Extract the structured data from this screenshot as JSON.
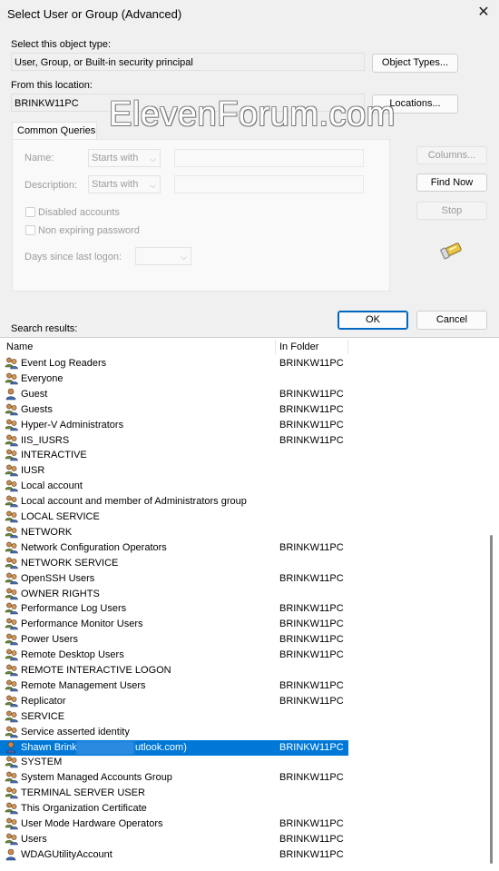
{
  "window": {
    "title": "Select User or Group (Advanced)"
  },
  "object_type": {
    "label": "Select this object type:",
    "value": "User, Group, or Built-in security principal",
    "button": "Object Types..."
  },
  "location": {
    "label": "From this location:",
    "value": "BRINKW11PC",
    "button": "Locations..."
  },
  "watermark": "ElevenForum.com",
  "common_queries": {
    "tab": "Common Queries",
    "name_label": "Name:",
    "name_match": "Starts with",
    "description_label": "Description:",
    "description_match": "Starts with",
    "disabled_accounts": "Disabled accounts",
    "non_expiring_password": "Non expiring password",
    "days_label": "Days since last logon:"
  },
  "buttons": {
    "columns": "Columns...",
    "find_now": "Find Now",
    "stop": "Stop",
    "ok": "OK",
    "cancel": "Cancel"
  },
  "search_results": {
    "label": "Search results:",
    "headers": {
      "name": "Name",
      "folder": "In Folder"
    },
    "rows": [
      {
        "name": "Event Log Readers",
        "folder": "BRINKW11PC",
        "icon": "group-icon"
      },
      {
        "name": "Everyone",
        "folder": "",
        "icon": "group-icon"
      },
      {
        "name": "Guest",
        "folder": "BRINKW11PC",
        "icon": "user-icon"
      },
      {
        "name": "Guests",
        "folder": "BRINKW11PC",
        "icon": "group-icon"
      },
      {
        "name": "Hyper-V Administrators",
        "folder": "BRINKW11PC",
        "icon": "group-icon"
      },
      {
        "name": "IIS_IUSRS",
        "folder": "BRINKW11PC",
        "icon": "group-icon"
      },
      {
        "name": "INTERACTIVE",
        "folder": "",
        "icon": "group-icon"
      },
      {
        "name": "IUSR",
        "folder": "",
        "icon": "group-icon"
      },
      {
        "name": "Local account",
        "folder": "",
        "icon": "group-icon"
      },
      {
        "name": "Local account and member of Administrators group",
        "folder": "",
        "icon": "group-icon"
      },
      {
        "name": "LOCAL SERVICE",
        "folder": "",
        "icon": "group-icon"
      },
      {
        "name": "NETWORK",
        "folder": "",
        "icon": "group-icon"
      },
      {
        "name": "Network Configuration Operators",
        "folder": "BRINKW11PC",
        "icon": "group-icon"
      },
      {
        "name": "NETWORK SERVICE",
        "folder": "",
        "icon": "group-icon"
      },
      {
        "name": "OpenSSH Users",
        "folder": "BRINKW11PC",
        "icon": "group-icon"
      },
      {
        "name": "OWNER RIGHTS",
        "folder": "",
        "icon": "group-icon"
      },
      {
        "name": "Performance Log Users",
        "folder": "BRINKW11PC",
        "icon": "group-icon"
      },
      {
        "name": "Performance Monitor Users",
        "folder": "BRINKW11PC",
        "icon": "group-icon"
      },
      {
        "name": "Power Users",
        "folder": "BRINKW11PC",
        "icon": "group-icon"
      },
      {
        "name": "Remote Desktop Users",
        "folder": "BRINKW11PC",
        "icon": "group-icon"
      },
      {
        "name": "REMOTE INTERACTIVE LOGON",
        "folder": "",
        "icon": "group-icon"
      },
      {
        "name": "Remote Management Users",
        "folder": "BRINKW11PC",
        "icon": "group-icon"
      },
      {
        "name": "Replicator",
        "folder": "BRINKW11PC",
        "icon": "group-icon"
      },
      {
        "name": "SERVICE",
        "folder": "",
        "icon": "group-icon"
      },
      {
        "name": "Service asserted identity",
        "folder": "",
        "icon": "group-icon"
      },
      {
        "name": "Shawn Brink utlook.com)",
        "folder": "BRINKW11PC",
        "icon": "user-icon",
        "selected": true
      },
      {
        "name": "SYSTEM",
        "folder": "",
        "icon": "group-icon"
      },
      {
        "name": "System Managed Accounts Group",
        "folder": "BRINKW11PC",
        "icon": "group-icon"
      },
      {
        "name": "TERMINAL SERVER USER",
        "folder": "",
        "icon": "group-icon"
      },
      {
        "name": "This Organization Certificate",
        "folder": "",
        "icon": "group-icon"
      },
      {
        "name": "User Mode Hardware Operators",
        "folder": "BRINKW11PC",
        "icon": "group-icon"
      },
      {
        "name": "Users",
        "folder": "BRINKW11PC",
        "icon": "group-icon"
      },
      {
        "name": "WDAGUtilityAccount",
        "folder": "BRINKW11PC",
        "icon": "user-icon"
      }
    ]
  },
  "colors": {
    "selection": "#0078d7",
    "primary_border": "#0067c0"
  }
}
